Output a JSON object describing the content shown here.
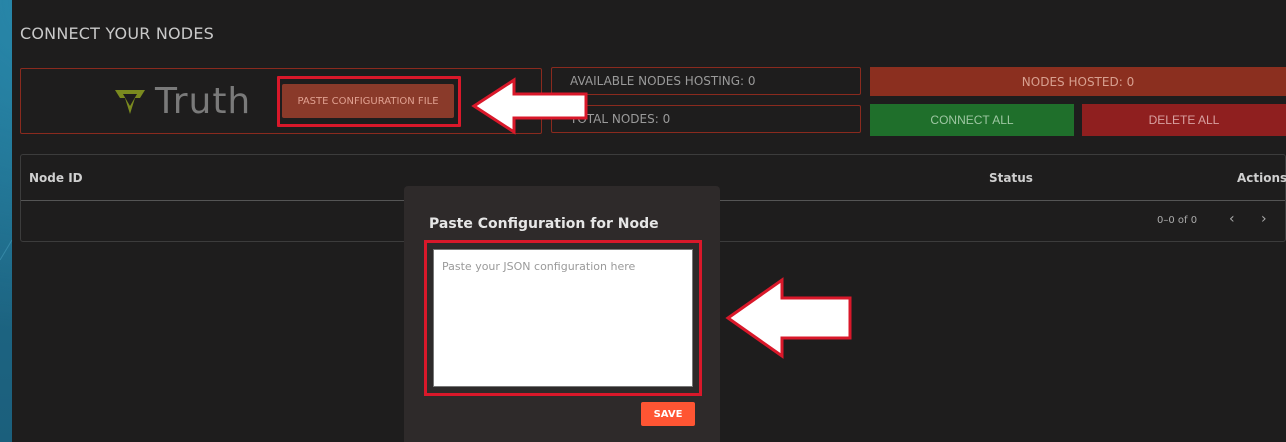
{
  "section_title": "CONNECT YOUR NODES",
  "brand": {
    "name": "Truth"
  },
  "paste_button_label": "PASTE CONFIGURATION FILE",
  "stats": {
    "available_label": "AVAILABLE NODES HOSTING: 0",
    "total_label": "TOTAL NODES: 0",
    "hosted_label": "NODES HOSTED: 0"
  },
  "actions": {
    "connect_all": "CONNECT ALL",
    "delete_all": "DELETE ALL"
  },
  "table": {
    "columns": [
      "Node ID",
      "Status",
      "Actions"
    ],
    "pagination": "0–0 of 0"
  },
  "modal": {
    "title": "Paste Configuration for Node",
    "placeholder": "Paste your JSON configuration here",
    "save_label": "SAVE"
  },
  "colors": {
    "accent_red": "#d9182a",
    "save": "#ff5533",
    "connect": "#1f6f2b",
    "delete": "#8f1f1f",
    "brand_green": "#7a8a1f"
  },
  "icons": [
    "truth-logo-icon",
    "chevron-left-icon",
    "chevron-right-icon",
    "arrow-pointer-icon"
  ]
}
